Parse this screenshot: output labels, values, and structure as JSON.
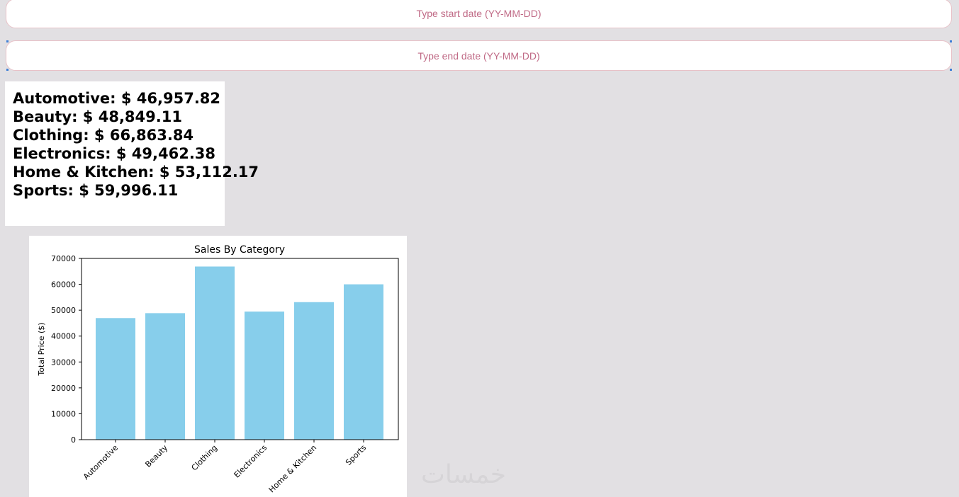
{
  "filters": {
    "start_placeholder": "Type start date (YY-MM-DD)",
    "end_placeholder": "Type end date (YY-MM-DD)"
  },
  "totals": [
    "Automotive: $ 46,957.82",
    "Beauty: $ 48,849.11",
    "Clothing: $ 66,863.84",
    "Electronics: $ 49,462.38",
    "Home & Kitchen: $ 53,112.17",
    "Sports: $ 59,996.11"
  ],
  "watermark": "خمسات",
  "colors": {
    "background": "#e2e0e3",
    "input_border": "#e8c2c8",
    "placeholder_text": "#c06a86",
    "bar_fill": "#87ceeb"
  },
  "chart_data": {
    "type": "bar",
    "title": "Sales By Category",
    "xlabel": "",
    "ylabel": "Total Price ($)",
    "categories": [
      "Automotive",
      "Beauty",
      "Clothing",
      "Electronics",
      "Home & Kitchen",
      "Sports"
    ],
    "values": [
      46957.82,
      48849.11,
      66863.84,
      49462.38,
      53112.17,
      59996.11
    ],
    "ylim": [
      0,
      70000
    ],
    "yticks": [
      0,
      10000,
      20000,
      30000,
      40000,
      50000,
      60000,
      70000
    ],
    "grid": false
  }
}
